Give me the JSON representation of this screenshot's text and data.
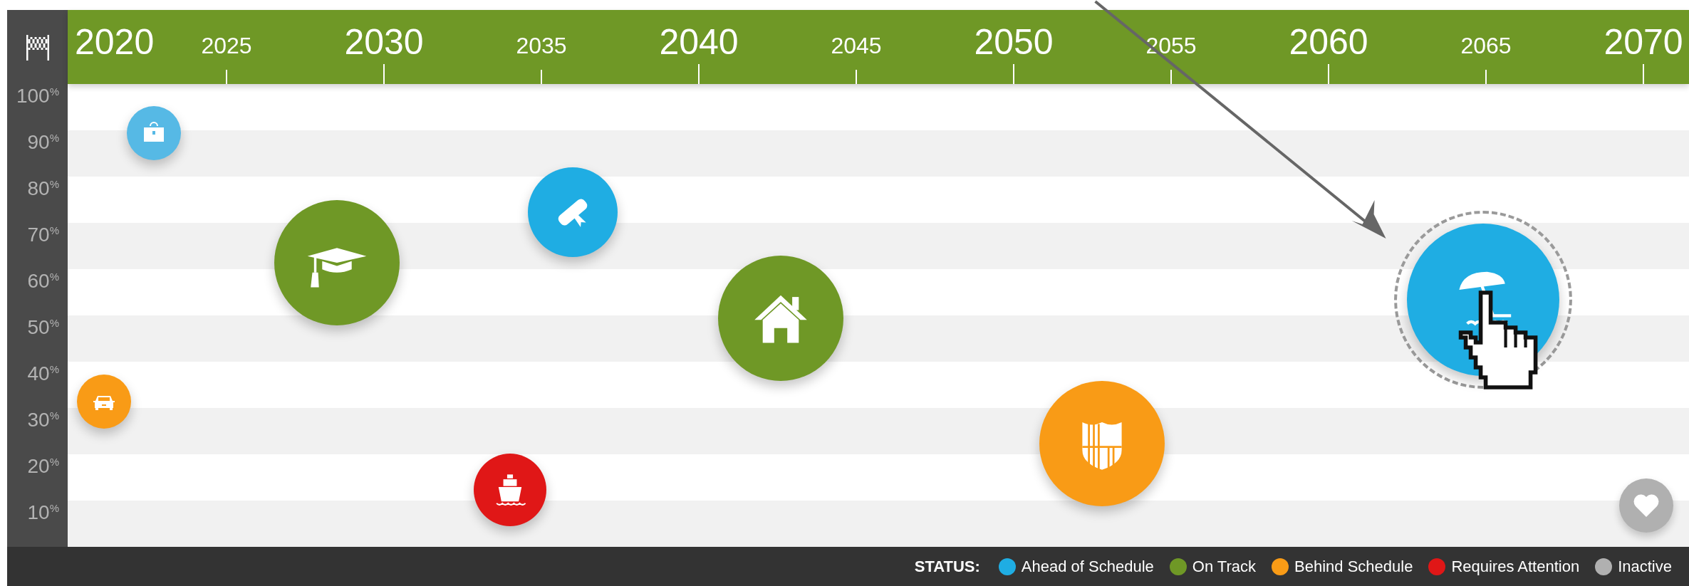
{
  "timeline": {
    "years": [
      "2020",
      "2025",
      "2030",
      "2035",
      "2040",
      "2045",
      "2050",
      "2055",
      "2060",
      "2065",
      "2070"
    ],
    "percent_labels": [
      "100$^{%}$",
      "90$^{%}$",
      "80$^{%}$",
      "70$^{%}$",
      "60$^{%}$",
      "50$^{%}$",
      "40$^{%}$",
      "30$^{%}$",
      "20$^{%}$",
      "10$^{%}$"
    ],
    "goals": [
      {
        "kind": "briefcase",
        "color": "#56b9e5",
        "selected": false
      },
      {
        "kind": "cap",
        "color": "#6f9826",
        "selected": false
      },
      {
        "kind": "diploma",
        "color": "#1fade3",
        "selected": false
      },
      {
        "kind": "house",
        "color": "#6f9826",
        "selected": false
      },
      {
        "kind": "car",
        "color": "#f99b16",
        "selected": false
      },
      {
        "kind": "ship",
        "color": "#e01717",
        "selected": false
      },
      {
        "kind": "shield",
        "color": "#f99b16",
        "selected": false
      },
      {
        "kind": "umbrella",
        "color": "#1fade3",
        "selected": true
      }
    ]
  },
  "status_bar": {
    "title": "STATUS:",
    "legend": [
      {
        "label": "Ahead of Schedule",
        "color": "#1fade3"
      },
      {
        "label": "On Track",
        "color": "#6f9826"
      },
      {
        "label": "Behind Schedule",
        "color": "#f99b16"
      },
      {
        "label": "Requires Attention",
        "color": "#e01717"
      },
      {
        "label": "Inactive",
        "color": "#b0b0b0"
      }
    ]
  }
}
